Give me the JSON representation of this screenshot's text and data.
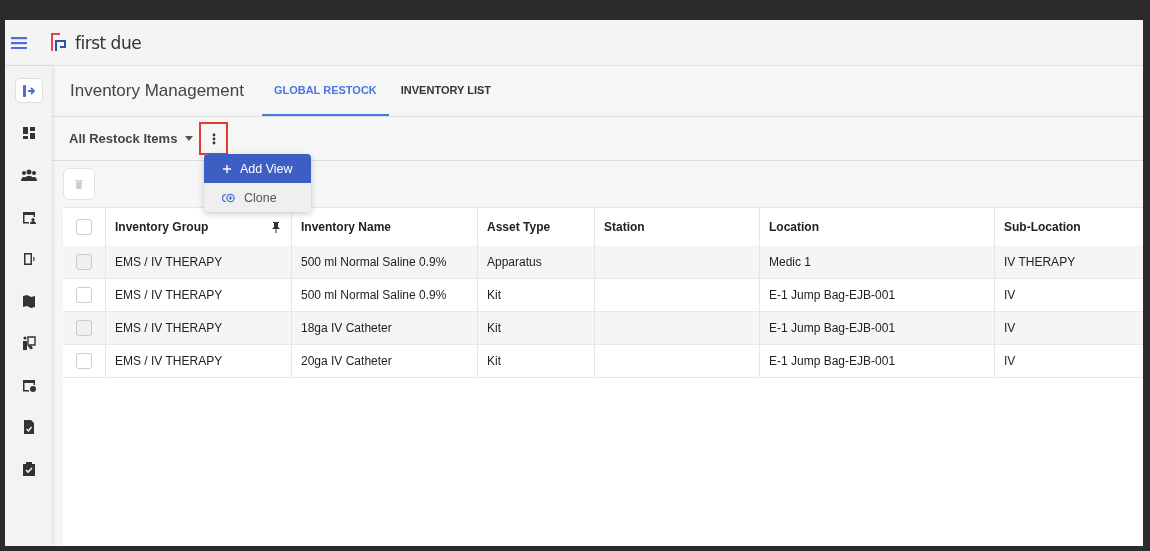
{
  "header": {
    "logo_text": "first due"
  },
  "sidebar": {
    "items": [
      {
        "selected": true
      },
      {
        "selected": false
      },
      {
        "selected": false
      },
      {
        "selected": false
      },
      {
        "selected": false
      },
      {
        "selected": false
      },
      {
        "selected": false
      },
      {
        "selected": false
      },
      {
        "selected": false
      },
      {
        "selected": false
      }
    ]
  },
  "page_title": "Inventory Management",
  "tabs": [
    {
      "label": "GLOBAL RESTOCK",
      "selected": true
    },
    {
      "label": "INVENTORY LIST",
      "selected": false
    }
  ],
  "view_selector": {
    "label": "All Restock Items",
    "menu_button_highlighted": true
  },
  "view_menu": [
    {
      "kind": "add",
      "label": "Add View",
      "selected": true
    },
    {
      "kind": "clone",
      "label": "Clone",
      "selected": false
    }
  ],
  "delete_button": {
    "disabled": true
  },
  "table": {
    "select_all_checked": false,
    "columns": [
      {
        "label": "Inventory Group",
        "pinned": true
      },
      {
        "label": "Inventory Name",
        "pinned": false
      },
      {
        "label": "Asset Type",
        "pinned": false
      },
      {
        "label": "Station",
        "pinned": false
      },
      {
        "label": "Location",
        "pinned": false
      },
      {
        "label": "Sub-Location",
        "pinned": false
      }
    ],
    "rows": [
      {
        "checked": false,
        "cells": [
          "EMS / IV THERAPY",
          "500 ml Normal Saline 0.9%",
          "Apparatus",
          "",
          "Medic 1",
          "IV THERAPY"
        ]
      },
      {
        "checked": false,
        "cells": [
          "EMS / IV THERAPY",
          "500 ml Normal Saline 0.9%",
          "Kit",
          "",
          "E-1 Jump Bag-EJB-001",
          "IV"
        ]
      },
      {
        "checked": false,
        "cells": [
          "EMS / IV THERAPY",
          "18ga IV Catheter",
          "Kit",
          "",
          "E-1 Jump Bag-EJB-001",
          "IV"
        ]
      },
      {
        "checked": false,
        "cells": [
          "EMS / IV THERAPY",
          "20ga IV Catheter",
          "Kit",
          "",
          "E-1 Jump Bag-EJB-001",
          "IV"
        ]
      }
    ]
  }
}
